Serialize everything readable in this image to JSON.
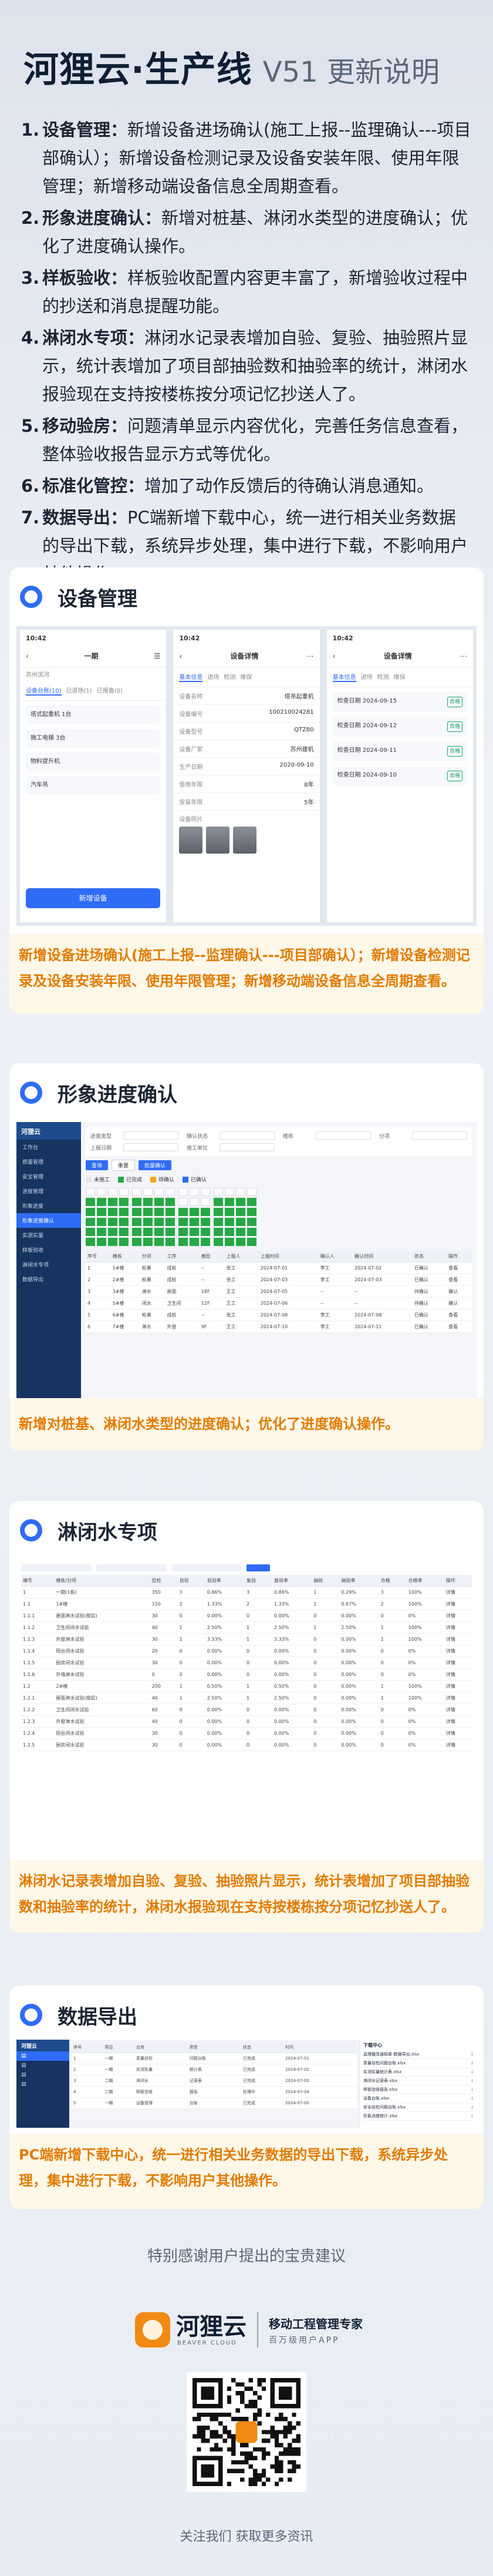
{
  "header": {
    "brand": "河狸云·生产线",
    "version": "V51 更新说明"
  },
  "notes": [
    {
      "num": "1.",
      "title": "设备管理：",
      "text": "新增设备进场确认(施工上报--监理确认---项目部确认）；新增设备检测记录及设备安装年限、使用年限管理；新增移动端设备信息全周期查看。"
    },
    {
      "num": "2.",
      "title": "形象进度确认：",
      "text": "新增对桩基、淋闭水类型的进度确认；优化了进度确认操作。"
    },
    {
      "num": "3.",
      "title": "样板验收：",
      "text": "样板验收配置内容更丰富了，新增验收过程中的抄送和消息提醒功能。"
    },
    {
      "num": "4.",
      "title": "淋闭水专项：",
      "text": "淋闭水记录表增加自验、复验、抽验照片显示，统计表增加了项目部抽验数和抽验率的统计，淋闭水报验现在支持按楼栋按分项记忆抄送人了。"
    },
    {
      "num": "5.",
      "title": "移动验房：",
      "text": "问题清单显示内容优化，完善任务信息查看，整体验收报告显示方式等优化。"
    },
    {
      "num": "6.",
      "title": "标准化管控：",
      "text": "增加了动作反馈后的待确认消息通知。"
    },
    {
      "num": "7.",
      "title": "数据导出：",
      "text": "PC端新增下载中心，统一进行相关业务数据的导出下载，系统异步处理，集中进行下载，不影响用户其他操作。"
    }
  ],
  "sections": {
    "device": {
      "title": "设备管理",
      "caption": "新增设备进场确认(施工上报--监理确认---项目部确认）；新增设备检测记录及设备安装年限、使用年限管理；新增移动端设备信息全周期查看。",
      "phone1": {
        "time": "10:42",
        "title": "一期",
        "sub": "苏州滨河",
        "tabs": [
          "设备台账(10)",
          "已退场(1)",
          "已报备(0)"
        ],
        "items": [
          "塔式起重机 1台",
          "施工电梯 3台",
          "物料提升机",
          "汽车吊"
        ],
        "button": "新增设备"
      },
      "phone2": {
        "time": "10:42",
        "title": "设备详情",
        "tabs": [
          "基本信息",
          "进场",
          "检测",
          "维保"
        ],
        "rows": [
          [
            "设备名称",
            "塔吊起重机"
          ],
          [
            "设备编号",
            "100210024281"
          ],
          [
            "设备型号",
            "QTZ80"
          ],
          [
            "设备厂家",
            "苏州建机"
          ],
          [
            "生产日期",
            "2020-09-10"
          ],
          [
            "使用年限",
            "8年"
          ],
          [
            "安装年限",
            "5年"
          ]
        ],
        "photos_label": "设备照片"
      },
      "phone3": {
        "time": "10:42",
        "title": "设备详情",
        "tabs": [
          "基本信息",
          "进场",
          "检测",
          "维保"
        ],
        "records": [
          [
            "检查日期",
            "2024-09-15",
            "合格"
          ],
          [
            "检查日期",
            "2024-09-12",
            "合格"
          ],
          [
            "检查日期",
            "2024-09-11",
            "合格"
          ],
          [
            "检查日期",
            "2024-09-10",
            "合格"
          ]
        ]
      }
    },
    "progress": {
      "title": "形象进度确认",
      "caption": "新增对桩基、淋闭水类型的进度确认；优化了进度确认操作。",
      "app": "河狸云",
      "menu": [
        "工作台",
        "质量管理",
        "安全管理",
        "进度管理",
        "形象进度",
        "形象进度确认",
        "实测实量",
        "样板验收",
        "淋闭水专项",
        "数据导出"
      ],
      "form_labels": [
        "进度类型",
        "确认状态",
        "楼栋",
        "分项",
        "上报日期",
        "施工单位"
      ],
      "buttons": [
        "查询",
        "重置",
        "批量确认"
      ],
      "legend": [
        "未施工",
        "已完成",
        "待确认",
        "已确认"
      ],
      "columns": [
        "序号",
        "楼栋",
        "分项",
        "工序",
        "楼层",
        "上报人",
        "上报时间",
        "确认人",
        "确认时间",
        "状态",
        "操作"
      ],
      "rows": [
        [
          "1",
          "1#楼",
          "桩基",
          "成桩",
          "--",
          "张工",
          "2024-07-01",
          "李工",
          "2024-07-02",
          "已确认",
          "查看"
        ],
        [
          "2",
          "2#楼",
          "桩基",
          "成桩",
          "--",
          "张工",
          "2024-07-03",
          "李工",
          "2024-07-03",
          "已确认",
          "查看"
        ],
        [
          "3",
          "3#楼",
          "淋水",
          "屋面",
          "18F",
          "王工",
          "2024-07-05",
          "--",
          "--",
          "待确认",
          "确认"
        ],
        [
          "4",
          "5#楼",
          "闭水",
          "卫生间",
          "12F",
          "王工",
          "2024-07-06",
          "--",
          "--",
          "待确认",
          "确认"
        ],
        [
          "5",
          "6#楼",
          "桩基",
          "成桩",
          "--",
          "张工",
          "2024-07-08",
          "李工",
          "2024-07-08",
          "已确认",
          "查看"
        ],
        [
          "6",
          "7#楼",
          "淋水",
          "外窗",
          "9F",
          "王工",
          "2024-07-10",
          "李工",
          "2024-07-11",
          "已确认",
          "查看"
        ]
      ]
    },
    "water": {
      "title": "淋闭水专项",
      "caption": "淋闭水记录表增加自验、复验、抽验照片显示，统计表增加了项目部抽验数和抽验率的统计，淋闭水报验现在支持按楼栋按分项记忆抄送人了。",
      "columns": [
        "编号",
        "楼栋/分项",
        "应检",
        "自验",
        "自验率",
        "复验",
        "复验率",
        "抽验",
        "抽验率",
        "合格",
        "合格率",
        "操作"
      ],
      "rows": [
        [
          "1",
          "一期(1栋)",
          "350",
          "3",
          "0.86%",
          "3",
          "0.86%",
          "1",
          "0.29%",
          "3",
          "100%",
          "详情"
        ],
        [
          "1.1",
          "1#楼",
          "150",
          "2",
          "1.33%",
          "2",
          "1.33%",
          "1",
          "0.67%",
          "2",
          "100%",
          "详情"
        ],
        [
          "1.1.1",
          "屋面淋水试验(按层)",
          "30",
          "0",
          "0.00%",
          "0",
          "0.00%",
          "0",
          "0.00%",
          "0",
          "0%",
          "详情"
        ],
        [
          "1.1.2",
          "卫生间闭水试验",
          "40",
          "1",
          "2.50%",
          "1",
          "2.50%",
          "1",
          "2.50%",
          "1",
          "100%",
          "详情"
        ],
        [
          "1.1.3",
          "外窗淋水试验",
          "30",
          "1",
          "3.33%",
          "1",
          "3.33%",
          "0",
          "0.00%",
          "1",
          "100%",
          "详情"
        ],
        [
          "1.1.4",
          "阳台闭水试验",
          "20",
          "0",
          "0.00%",
          "0",
          "0.00%",
          "0",
          "0.00%",
          "0",
          "0%",
          "详情"
        ],
        [
          "1.1.5",
          "厨房闭水试验",
          "30",
          "0",
          "0.00%",
          "0",
          "0.00%",
          "0",
          "0.00%",
          "0",
          "0%",
          "详情"
        ],
        [
          "1.1.6",
          "外墙淋水试验",
          "0",
          "0",
          "0.00%",
          "0",
          "0.00%",
          "0",
          "0.00%",
          "0",
          "0%",
          "详情"
        ],
        [
          "1.2",
          "2#楼",
          "200",
          "1",
          "0.50%",
          "1",
          "0.50%",
          "0",
          "0.00%",
          "1",
          "100%",
          "详情"
        ],
        [
          "1.2.1",
          "屋面淋水试验(按层)",
          "40",
          "1",
          "2.50%",
          "1",
          "2.50%",
          "0",
          "0.00%",
          "1",
          "100%",
          "详情"
        ],
        [
          "1.2.2",
          "卫生间闭水试验",
          "60",
          "0",
          "0.00%",
          "0",
          "0.00%",
          "0",
          "0.00%",
          "0",
          "0%",
          "详情"
        ],
        [
          "1.2.3",
          "外窗淋水试验",
          "40",
          "0",
          "0.00%",
          "0",
          "0.00%",
          "0",
          "0.00%",
          "0",
          "0%",
          "详情"
        ],
        [
          "1.2.4",
          "阳台闭水试验",
          "30",
          "0",
          "0.00%",
          "0",
          "0.00%",
          "0",
          "0.00%",
          "0",
          "0%",
          "详情"
        ],
        [
          "1.2.5",
          "厨房闭水试验",
          "30",
          "0",
          "0.00%",
          "0",
          "0.00%",
          "0",
          "0.00%",
          "0",
          "0%",
          "详情"
        ]
      ]
    },
    "export": {
      "title": "数据导出",
      "caption": "PC端新增下载中心，统一进行相关业务数据的导出下载，系统异步处理，集中进行下载，不影响用户其他操作。",
      "app": "河狸云",
      "panel_title": "下载中心",
      "columns": [
        "序号",
        "项目",
        "业务",
        "类型",
        "状态",
        "时间"
      ],
      "rows": [
        [
          "1",
          "一期",
          "质量巡检",
          "问题台账",
          "已完成",
          "2024-07-01"
        ],
        [
          "2",
          "一期",
          "实测实量",
          "统计表",
          "已完成",
          "2024-07-02"
        ],
        [
          "3",
          "二期",
          "淋闭水",
          "记录表",
          "已完成",
          "2024-07-03"
        ],
        [
          "4",
          "二期",
          "样板验收",
          "报告",
          "处理中",
          "2024-07-04"
        ],
        [
          "5",
          "一期",
          "设备管理",
          "台账",
          "已完成",
          "2024-07-05"
        ]
      ],
      "files": [
        "监理整改通知单-数据导出.xlsx",
        "质量巡检问题台账.xlsx",
        "实测实量统计表.xlsx",
        "淋闭水记录表.xlsx",
        "样板验收报告.xlsx",
        "设备台账.xlsx",
        "安全巡检问题台账.xlsx",
        "形象进度统计.xlsx"
      ]
    }
  },
  "footer": {
    "thanks": "特别感谢用户提出的宝贵建议",
    "brand": "河狸云",
    "brand_en": "BEAVER CLOUD",
    "slogan": "移动工程管理专家",
    "sub": "百万级用户APP",
    "follow": "关注我们 获取更多资讯"
  },
  "colors": {
    "accent": "#2f6cf6",
    "caption_text": "#e07b00",
    "caption_bg": "#fff7e8",
    "green": "#27a845"
  }
}
